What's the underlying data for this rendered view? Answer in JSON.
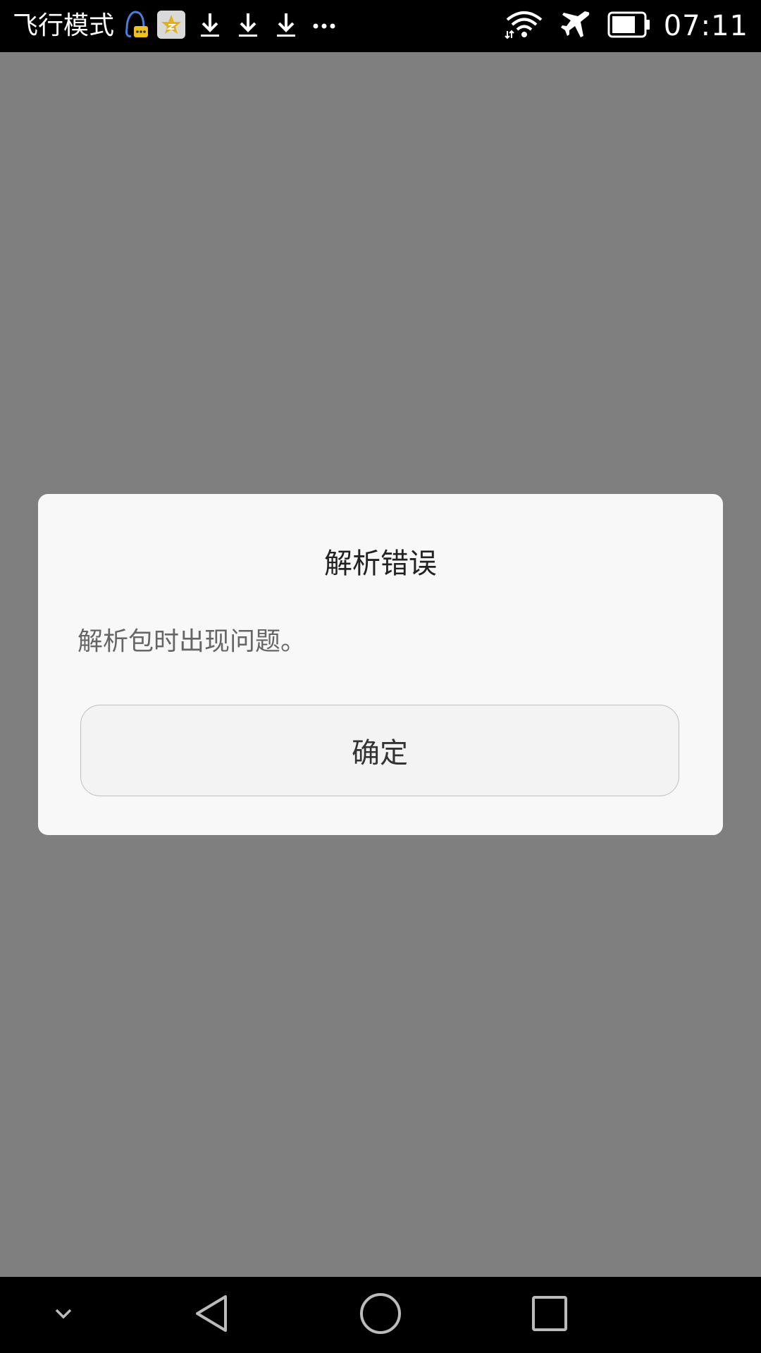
{
  "status_bar": {
    "carrier": "飞行模式",
    "time": "07:11",
    "icons": [
      "qq-icon",
      "star-app-icon",
      "download-icon",
      "download-icon",
      "download-icon",
      "more-icon",
      "wifi-icon",
      "airplane-icon",
      "battery-icon"
    ]
  },
  "dialog": {
    "title": "解析错误",
    "message": "解析包时出现问题。",
    "confirm_label": "确定"
  },
  "nav_bar": {
    "buttons": [
      "collapse-icon",
      "back-icon",
      "home-icon",
      "recents-icon"
    ]
  },
  "colors": {
    "overlay": "#7f7f7f",
    "dialog_bg": "#f8f8f8",
    "bar_bg": "#000000"
  }
}
